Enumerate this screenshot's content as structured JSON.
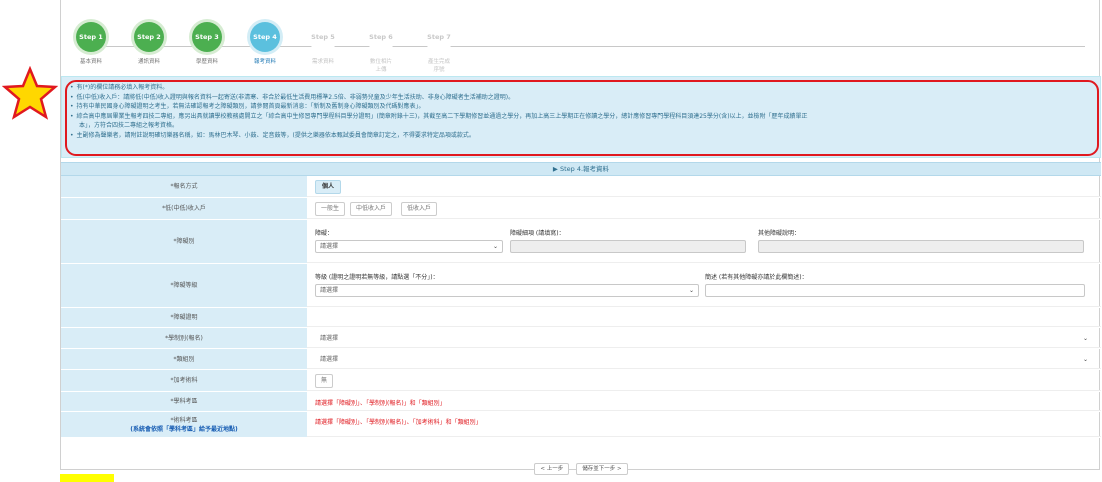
{
  "steps": [
    {
      "name": "Step 1",
      "label": "基本資料",
      "status": "done"
    },
    {
      "name": "Step 2",
      "label": "通訊資料",
      "status": "done"
    },
    {
      "name": "Step 3",
      "label": "學歷資料",
      "status": "done"
    },
    {
      "name": "Step 4",
      "label": "報考資料",
      "status": "current"
    },
    {
      "name": "Step 5",
      "label": "需求資料",
      "status": "todo"
    },
    {
      "name": "Step 6",
      "label": "數位相片\n上傳",
      "status": "todo"
    },
    {
      "name": "Step 7",
      "label": "產生完成\n序號",
      "status": "todo"
    }
  ],
  "notice": {
    "items": [
      "有(*)的欄位請務必填入報考資料。",
      "低(中低)收入戶：請將低(中低)收入證明與報名資料一起寄送(非清寒、非合於最低生活費用標準2.5倍、非弱勢兒童及少年生活扶助、非身心障礙者生活補助之證明)。",
      "持有中華民國身心障礙證明之考生，若無法確認報考之障礙類別，請參閱首頁最新消息：「新制及舊制身心障礙類別及代碼對應表」。",
      "綜合高中應屆畢業生報考四技二專組，應另出具就讀學校教務處開立之「綜合高中生修習專門學程科目學分證明」(簡章附錄十三)，其截至高二下學期修習並通過之學分，再加上高三上學期正在修讀之學分，總計應修習專門學程科目須達25學分(含)以上，並檢附「歷年成績單正",
      "本」，方符合四技二專組之報考資格。",
      "主副修為聲樂者，請附註說明確切樂器名稱，如：馬林巴木琴、小鼓、定音鼓等，(提供之樂器依本甄試委員會簡章訂定之，不得要求特定品項或款式。"
    ]
  },
  "form": {
    "title": "▶ Step 4.報考資料",
    "labels": {
      "signup_mode": "*報名方式",
      "low_income": "*低(中低)收入戶",
      "disability_type": "*障礙別",
      "disability_grade": "*障礙等級",
      "disability_proof": "*障礙證明",
      "department": "*學制別(報名)",
      "group": "*類組別",
      "extra_subject": "*加考術科",
      "exam_area": "*學科考區",
      "skill_area": "*術科考區",
      "skill_area_sub": "(系統會依照「學科考區」給予最近地點)"
    },
    "signup_mode_value": "個人",
    "low_income_options": [
      "一般生",
      "中低收入戶",
      "低收入戶"
    ],
    "disability_label": "障礙：",
    "disability_detail_label": "障礙細項 (請填寫)：",
    "disability_other_label": "其他障礙說明：",
    "grade_label": "等級 (證明之證明若無等級，請點選「不分」)：",
    "grade_desc_label": "簡述 (若有其他障礙亦請於此欄簡述)：",
    "select_placeholder": "請選擇",
    "extra_subject_value": "無",
    "exam_area_warn": "請選擇「障礙別」、「學制別(報名)」和「類組別」",
    "skill_area_warn": "請選擇「障礙別」、「學制別(報名)」、「加考術科」和「類組別」"
  },
  "footer": {
    "prev": "< 上一步",
    "next": "儲存並下一步 >"
  },
  "highlight_text": "",
  "colors": {
    "step_done": "#4caf50",
    "step_current": "#5bc0de",
    "notice_bg": "#d9edf7",
    "annotation_red": "#e0191f",
    "star_fill": "#ffd700"
  }
}
